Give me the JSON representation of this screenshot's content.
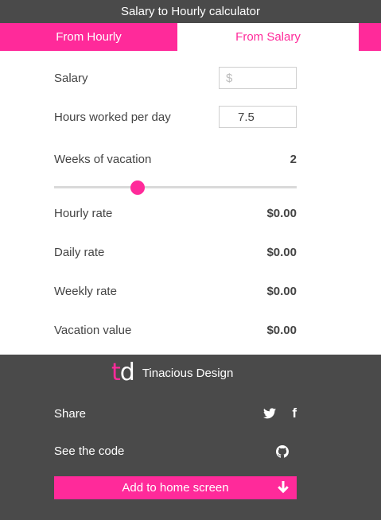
{
  "app": {
    "title": "Salary to Hourly calculator"
  },
  "tabs": [
    {
      "label": "From Hourly",
      "active": false
    },
    {
      "label": "From Salary",
      "active": true
    }
  ],
  "form": {
    "salary": {
      "label": "Salary",
      "value": "",
      "placeholder": "$"
    },
    "hours": {
      "label": "Hours worked per day",
      "value": "7.5"
    },
    "vacation": {
      "label": "Weeks of vacation",
      "value": "2",
      "slider_fraction": 0.345
    }
  },
  "results": [
    {
      "label": "Hourly rate",
      "value": "$0.00"
    },
    {
      "label": "Daily rate",
      "value": "$0.00"
    },
    {
      "label": "Weekly rate",
      "value": "$0.00"
    },
    {
      "label": "Vacation value",
      "value": "$0.00"
    }
  ],
  "footer": {
    "brand": {
      "logo_t": "t",
      "logo_d": "d",
      "name": "Tinacious Design"
    },
    "share_label": "Share",
    "code_label": "See the code",
    "add_button_label": "Add to home screen",
    "icons": [
      "twitter-icon",
      "facebook-icon",
      "github-icon",
      "arrow-down-icon"
    ]
  },
  "colors": {
    "accent": "#ff2a9a",
    "dark": "#4a4a4a",
    "text": "#444444"
  }
}
